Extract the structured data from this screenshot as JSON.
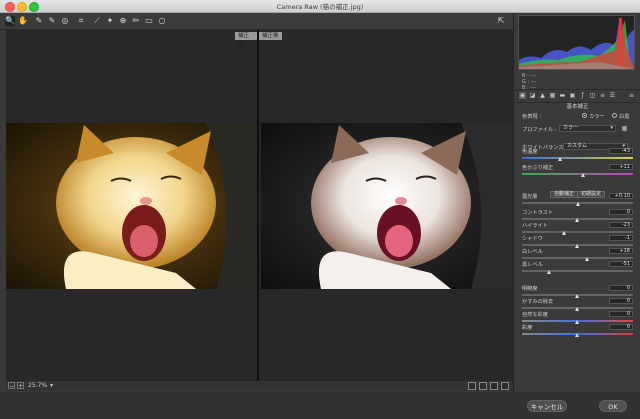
{
  "window": {
    "title": "Camera Raw (猫の補正.jpg)"
  },
  "toolbar": {
    "tools": [
      {
        "name": "zoom-tool",
        "glyph": "🔍"
      },
      {
        "name": "hand-tool",
        "glyph": "✋"
      },
      {
        "name": "white-balance-tool",
        "glyph": "✎"
      },
      {
        "name": "color-sampler-tool",
        "glyph": "✎"
      },
      {
        "name": "targeted-adjustment-tool",
        "glyph": "◎"
      },
      {
        "name": "crop-tool",
        "glyph": "⌗"
      },
      {
        "name": "straighten-tool",
        "glyph": "⟋"
      },
      {
        "name": "spot-removal-tool",
        "glyph": "✦"
      },
      {
        "name": "red-eye-tool",
        "glyph": "⊕"
      },
      {
        "name": "adjustment-brush-tool",
        "glyph": "✏"
      },
      {
        "name": "graduated-filter-tool",
        "glyph": "▭"
      },
      {
        "name": "radial-filter-tool",
        "glyph": "○"
      }
    ],
    "right_icon": "open-preferences-icon"
  },
  "preview": {
    "before_label": "補正前",
    "after_label": "補正後"
  },
  "status": {
    "zoom": "25.7%"
  },
  "buttons": {
    "cancel": "キャンセル",
    "ok": "OK"
  },
  "histogram": {
    "r": "R :  ---",
    "g": "G :  ---",
    "b": "B :  ---"
  },
  "panel": {
    "section_title": "基本補正",
    "treatment_label": "色表現 :",
    "treatment_color": "カラー",
    "treatment_bw": "白黒",
    "profile_label": "プロファイル :",
    "profile_value": "カラー",
    "wb_label": "ホワイトバランス :",
    "wb_value": "カスタム",
    "auto_label": "自動補正",
    "default_label": "初期設定",
    "sliders": [
      {
        "key": "temperature",
        "label": "色温度",
        "value": "-43",
        "pos": 0.35
      },
      {
        "key": "tint",
        "label": "色かぶり補正",
        "value": "+11",
        "pos": 0.55
      },
      {
        "key": "exposure",
        "label": "露光量",
        "value": "+0.10",
        "pos": 0.51
      },
      {
        "key": "contrast",
        "label": "コントラスト",
        "value": "0",
        "pos": 0.5
      },
      {
        "key": "highlights",
        "label": "ハイライト",
        "value": "-23",
        "pos": 0.38
      },
      {
        "key": "shadows",
        "label": "シャドウ",
        "value": "-1",
        "pos": 0.5
      },
      {
        "key": "whites",
        "label": "白レベル",
        "value": "+18",
        "pos": 0.59
      },
      {
        "key": "blacks",
        "label": "黒レベル",
        "value": "-51",
        "pos": 0.25
      },
      {
        "key": "texture",
        "label": "明瞭度",
        "value": "0",
        "pos": 0.5
      },
      {
        "key": "dehaze",
        "label": "かすみの除去",
        "value": "0",
        "pos": 0.5
      },
      {
        "key": "vibrance",
        "label": "自然な彩度",
        "value": "0",
        "pos": 0.5
      },
      {
        "key": "saturation",
        "label": "彩度",
        "value": "0",
        "pos": 0.5
      }
    ]
  }
}
